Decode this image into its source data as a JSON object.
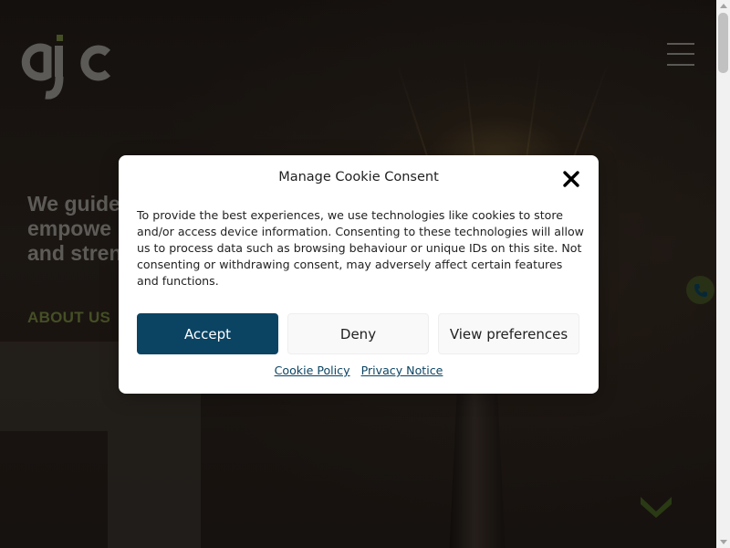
{
  "header": {
    "logo_text": "ajc",
    "logo_colors": {
      "main": "#8c8a86",
      "accent": "#6b7a3a"
    },
    "menu_icon": "hamburger-icon"
  },
  "hero": {
    "lines": [
      "We guide",
      "empowe",
      "and stren"
    ],
    "about_label": "ABOUT US"
  },
  "floating": {
    "phone_icon": "phone-icon",
    "scroll_icon": "chevron-down-icon"
  },
  "cookie_modal": {
    "title": "Manage Cookie Consent",
    "body": "To provide the best experiences, we use technologies like cookies to store and/or access device information. Consenting to these technologies will allow us to process data such as browsing behaviour or unique IDs on this site. Not consenting or withdrawing consent, may adversely affect certain features and functions.",
    "buttons": {
      "accept": "Accept",
      "deny": "Deny",
      "preferences": "View preferences"
    },
    "links": {
      "cookie_policy": "Cookie Policy",
      "privacy_notice": "Privacy Notice"
    },
    "close_icon": "close-icon"
  },
  "colors": {
    "accent_green": "#6b7a3a",
    "primary_blue": "#0b4463"
  }
}
